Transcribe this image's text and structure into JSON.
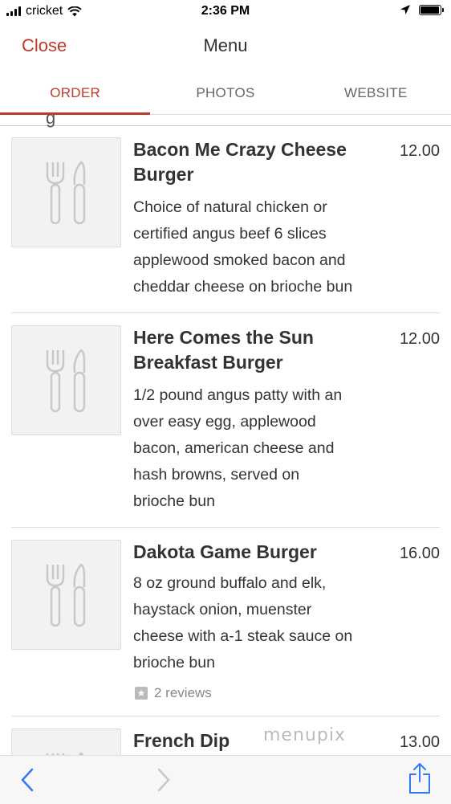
{
  "status_bar": {
    "carrier": "cricket",
    "time": "2:36 PM",
    "battery_level": 0.9
  },
  "navbar": {
    "close_label": "Close",
    "title": "Menu"
  },
  "tabs": [
    {
      "label": "ORDER",
      "active": true
    },
    {
      "label": "PHOTOS",
      "active": false
    },
    {
      "label": "WEBSITE",
      "active": false
    }
  ],
  "menu_items": [
    {
      "name_lines": [
        "Bacon Me Crazy Cheese",
        "Burger"
      ],
      "price": "12.00",
      "description_lines": [
        "Choice of natural chicken or",
        "certified angus beef 6 slices",
        "applewood smoked bacon and",
        "cheddar cheese on brioche bun"
      ]
    },
    {
      "name_lines": [
        "Here Comes the Sun",
        "Breakfast Burger"
      ],
      "price": "12.00",
      "description_lines": [
        "1/2 pound angus patty with an",
        "over easy egg, applewood",
        "bacon, american cheese and",
        "hash browns, served on",
        "brioche bun"
      ]
    },
    {
      "name_lines": [
        "Dakota Game Burger"
      ],
      "price": "16.00",
      "description_lines": [
        "8 oz ground buffalo and elk,",
        "haystack onion, muenster",
        "cheese with a-1 steak sauce on",
        "brioche bun"
      ],
      "reviews": "2 reviews"
    },
    {
      "name_lines": [
        "French Dip"
      ],
      "price": "13.00"
    }
  ],
  "watermark": "menupix",
  "colors": {
    "accent": "#c0392b",
    "toolbar_icon": "#3478f6"
  },
  "icons": {
    "thumbnail": "fork-knife-icon",
    "back": "chevron-left-icon",
    "forward": "chevron-right-icon",
    "share": "share-icon"
  }
}
